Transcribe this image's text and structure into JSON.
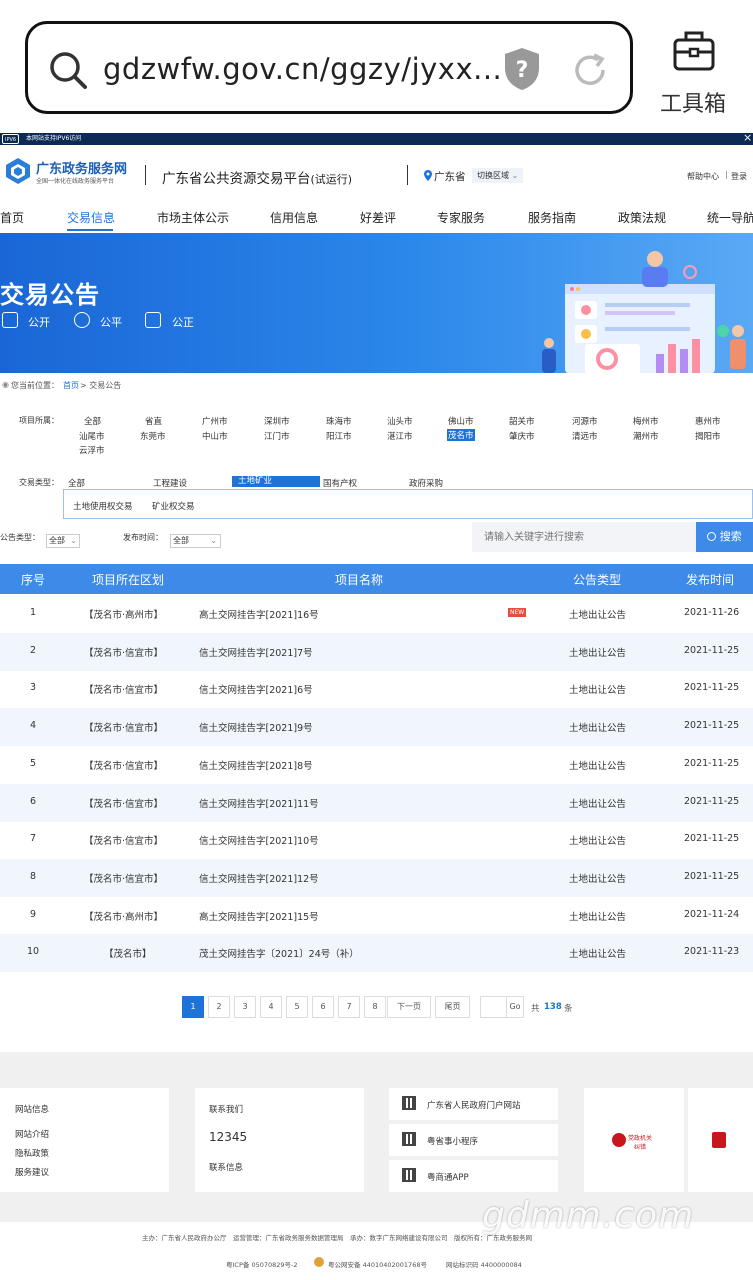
{
  "browser": {
    "url": "gdzwfw.gov.cn/ggzy/jyxx...",
    "tools_label": "工具箱"
  },
  "ipv_bar": {
    "badge": "IPV6",
    "text": "本网站支持IPV6访问",
    "close": "×"
  },
  "header": {
    "logo_title": "广东政务服务网",
    "logo_subtitle": "全国一体化在线政务服务平台",
    "platform_title": "广东省公共资源交易平台",
    "platform_suffix": "(试运行)",
    "region": "广东省",
    "switch_region": "切换区域",
    "help": "帮助中心",
    "divider": "|",
    "login": "登录"
  },
  "nav": [
    "首页",
    "交易信息",
    "市场主体公示",
    "信用信息",
    "好差评",
    "专家服务",
    "服务指南",
    "政策法规",
    "统一导航"
  ],
  "banner": {
    "title": "交易公告",
    "tags": [
      "公开",
      "公平",
      "公正"
    ]
  },
  "breadcrumb": {
    "prefix": "您当前位置：",
    "home": "首页",
    "current": "> 交易公告"
  },
  "filter": {
    "project_label": "项目所属：",
    "cities": [
      "全部",
      "省直",
      "广州市",
      "深圳市",
      "珠海市",
      "汕头市",
      "佛山市",
      "韶关市",
      "河源市",
      "梅州市",
      "惠州市",
      "汕尾市",
      "东莞市",
      "中山市",
      "江门市",
      "阳江市",
      "湛江市",
      "茂名市",
      "肇庆市",
      "清远市",
      "潮州市",
      "揭阳市",
      "云浮市"
    ],
    "selected_city": "茂名市",
    "trade_label": "交易类型：",
    "trade_types": [
      "全部",
      "工程建设",
      "土地矿业",
      "国有产权",
      "政府采购"
    ],
    "selected_trade": "土地矿业",
    "sub_types": [
      "土地使用权交易",
      "矿业权交易"
    ],
    "notice_type_label": "公告类型：",
    "notice_type_value": "全部",
    "publish_time_label": "发布时间：",
    "publish_time_value": "全部",
    "search_placeholder": "请输入关键字进行搜索",
    "search_button": "搜索"
  },
  "table": {
    "headers": [
      "序号",
      "项目所在区划",
      "项目名称",
      "公告类型",
      "发布时间"
    ],
    "new_badge": "NEW",
    "rows": [
      {
        "no": "1",
        "region": "【茂名市·高州市】",
        "name": "高土交网挂告字[2021]16号",
        "type": "土地出让公告",
        "date": "2021-11-26",
        "is_new": true
      },
      {
        "no": "2",
        "region": "【茂名市·信宜市】",
        "name": "信土交网挂告字[2021]7号",
        "type": "土地出让公告",
        "date": "2021-11-25"
      },
      {
        "no": "3",
        "region": "【茂名市·信宜市】",
        "name": "信土交网挂告字[2021]6号",
        "type": "土地出让公告",
        "date": "2021-11-25"
      },
      {
        "no": "4",
        "region": "【茂名市·信宜市】",
        "name": "信土交网挂告字[2021]9号",
        "type": "土地出让公告",
        "date": "2021-11-25"
      },
      {
        "no": "5",
        "region": "【茂名市·信宜市】",
        "name": "信土交网挂告字[2021]8号",
        "type": "土地出让公告",
        "date": "2021-11-25"
      },
      {
        "no": "6",
        "region": "【茂名市·信宜市】",
        "name": "信土交网挂告字[2021]11号",
        "type": "土地出让公告",
        "date": "2021-11-25"
      },
      {
        "no": "7",
        "region": "【茂名市·信宜市】",
        "name": "信土交网挂告字[2021]10号",
        "type": "土地出让公告",
        "date": "2021-11-25"
      },
      {
        "no": "8",
        "region": "【茂名市·信宜市】",
        "name": "信土交网挂告字[2021]12号",
        "type": "土地出让公告",
        "date": "2021-11-25"
      },
      {
        "no": "9",
        "region": "【茂名市·高州市】",
        "name": "高土交网挂告字[2021]15号",
        "type": "土地出让公告",
        "date": "2021-11-24"
      },
      {
        "no": "10",
        "region": "【茂名市】",
        "name": "茂土交网挂告字〔2021〕24号（补）",
        "type": "土地出让公告",
        "date": "2021-11-23"
      }
    ]
  },
  "pager": {
    "pages": [
      "1",
      "2",
      "3",
      "4",
      "5",
      "6",
      "7",
      "8"
    ],
    "next": "下一页",
    "last": "尾页",
    "go": "Go",
    "total_prefix": "共",
    "total": "138",
    "total_suffix": "条"
  },
  "footer": {
    "site_info_title": "网站信息",
    "site_links": [
      "网站介绍",
      "隐私政策",
      "服务建议"
    ],
    "contact_title": "联系我们",
    "phone": "12345",
    "contact_info": "联系信息",
    "qr_links": [
      "广东省人民政府门户网站",
      "粤省事小程序",
      "粤商通APP"
    ],
    "badge1": "党政机关",
    "badge1_sub": "纠错",
    "sponsor_line": "主办：广东省人民政府办公厅　运营管理：广东省政务服务数据管理局　承办：数字广东网络建设有限公司　版权所有：广东政务服务网",
    "icp": "粤ICP备 05070829号-2",
    "police": "粤公网安备 44010402001768号",
    "site_code": "网站标识码 4400000084"
  },
  "watermark": "gdmm.com",
  "colors": {
    "primary": "#3e8ae8",
    "header_blue": "#1a66d6",
    "new_red": "#e74c3c",
    "selected_blue": "#1e73d8"
  }
}
